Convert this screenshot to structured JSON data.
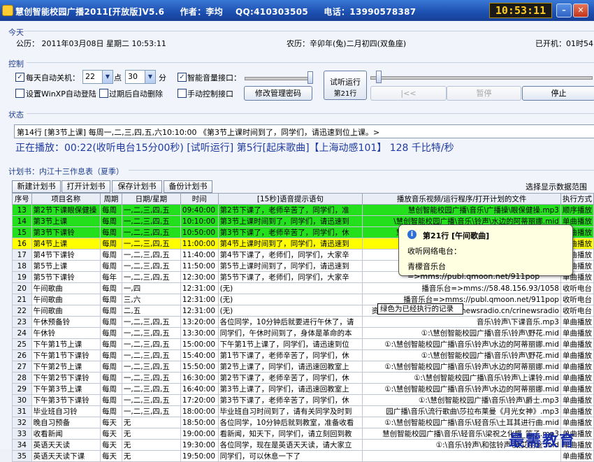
{
  "app": {
    "title": "慧创智能校园广播2011[开放版]V5.6",
    "author": "作者：李均",
    "qq": "QQ:410303505",
    "phone": "电话：13990578387",
    "clock": "10:53:11"
  },
  "today": {
    "group_label": "今天",
    "gregorian": "公历：  2011年03月08日  星期二  10:53:11",
    "lunar": "农历：辛卯年(兔)二月初四(双鱼座)",
    "uptime": "已开机：01时54"
  },
  "control": {
    "group_label": "控制",
    "auto_shutdown_label": "每天自动关机：",
    "hour_value": "22",
    "hour_unit": "点",
    "minute_value": "30",
    "minute_unit": "分",
    "smart_volume_label": "智能音量接口：",
    "setup_winxp_label": "设置WinXP自动登陆",
    "expired_delete_label": "过期后自动删除",
    "manual_control_label": "手动控制接口",
    "change_password_button": "修改管理密码",
    "trial_run_button_line1": "试听运行",
    "trial_run_button_line2": "第21行",
    "first_button": "|<<",
    "pause_button": "暂停",
    "stop_button": "停止"
  },
  "status": {
    "group_label": "状态",
    "line": "第14行  [第3节上课]  每周一,二,三,四,五,六10:10:00  《第3节上课时间到了，同学们，请迅速到位上课。>",
    "playing": "正在播放：00:22(收听电台15分00秒) [试听运行] 第5行[起床歌曲]【上海动感101】 128 千比特/秒"
  },
  "plan": {
    "header": "计划书：内江十三作息表（夏季）",
    "new_button": "新建计划书",
    "open_button": "打开计划书",
    "save_button": "保存计划书",
    "backup_button": "备份计划书",
    "range_label": "选择显示数据范围"
  },
  "table": {
    "columns": [
      "序号",
      "项目名称",
      "周期",
      "日期/星期",
      "时间",
      "[15秒]语音提示语句",
      "播放音乐视频/运行程序/打开计划的文件",
      "执行方式"
    ],
    "rows": [
      {
        "n": "13",
        "name": "第2节下课眼保健操",
        "period": "每周",
        "days": "一,二,三,四,五",
        "time": "09:40:00",
        "voice": "第2节下课了，老师辛苦了，同学们，准",
        "file": "慧创智能校园广播\\音乐\\广播操\\眼保健操.mp3",
        "mode": "顺序播放",
        "hl": "green"
      },
      {
        "n": "14",
        "name": "第3节上课",
        "period": "每周",
        "days": "一,二,三,四,五",
        "time": "10:10:00",
        "voice": "第3节上课时间到了，同学们，请迅速到",
        "file": "\\慧创智能校园广播\\音乐\\铃声\\水边的阿蒂丽娜.mid",
        "mode": "单曲播放",
        "hl": "green"
      },
      {
        "n": "15",
        "name": "第3节下课铃",
        "period": "每周",
        "days": "一,二,三,四,五",
        "time": "10:50:00",
        "voice": "第3节下课了，老师辛苦了，同学们，休",
        "file": "慧创智能校园广播\\音乐\\铃声\\水边的阿蒂丽娜.mid",
        "mode": "单曲播放",
        "hl": "green"
      },
      {
        "n": "16",
        "name": "第4节上课",
        "period": "每周",
        "days": "一,二,三,四,五",
        "time": "11:00:00",
        "voice": "第4节上课时间到了，同学们，请迅速到",
        "file": "\\慧创智能校园广播",
        "mode": "单曲播放",
        "hl": "yellow"
      },
      {
        "n": "17",
        "name": "第4节下课铃",
        "period": "每周",
        "days": "一,二,三,四,五",
        "time": "11:40:00",
        "voice": "第4节下课了，老师们，同学们，大家辛",
        "file": "",
        "mode": "单曲播放",
        "hl": ""
      },
      {
        "n": "18",
        "name": "第5节上课",
        "period": "每周",
        "days": "一,二,三,四,五",
        "time": "11:50:00",
        "voice": "第5节上课时间到了，同学们，请迅速到",
        "file": "",
        "mode": "单曲播放",
        "hl": ""
      },
      {
        "n": "19",
        "name": "第5节下课铃",
        "period": "每年",
        "days": "一,二,三,四,五",
        "time": "12:30:00",
        "voice": "第5节下课了，老师们，同学们，大家辛",
        "file": "",
        "mode": "单曲播放",
        "hl": ""
      },
      {
        "n": "20",
        "name": "午间歌曲",
        "period": "每周",
        "days": "一,四",
        "time": "12:31:00",
        "voice": "(无)",
        "file": "播音乐台=>mms://58.48.156.93/1058",
        "mode": "收听电台",
        "hl": ""
      },
      {
        "n": "21",
        "name": "午间歌曲",
        "period": "每周",
        "days": "三,六",
        "time": "12:31:00",
        "voice": "(无)",
        "file": "播音乐台=>mms://publ.qmoon.net/911pop",
        "mode": "收听电台",
        "hl": ""
      },
      {
        "n": "22",
        "name": "午间歌曲",
        "period": "每周",
        "days": "二,五",
        "time": "12:31:00",
        "voice": "(无)",
        "file": "资讯)=>mms://media.crinewsradio.cn/crinewsradio",
        "mode": "收听电台",
        "hl": ""
      },
      {
        "n": "23",
        "name": "午休预备铃",
        "period": "每周",
        "days": "一,二,三,四,五",
        "time": "13:20:00",
        "voice": "各位同学，10分钟后就要进行午休了，请",
        "file": "音乐\\铃声\\下课音乐.mp3",
        "mode": "单曲播放",
        "hl": ""
      },
      {
        "n": "24",
        "name": "午休铃",
        "period": "每周",
        "days": "一,二,三,四,五",
        "time": "13:30:00",
        "voice": "同学们，午休时间到了，身体是革命的本",
        "file": "①:\\慧创智能校园广播\\音乐\\铃声\\野花.mid",
        "mode": "单曲播放",
        "hl": ""
      },
      {
        "n": "25",
        "name": "下午第1节上课",
        "period": "每周",
        "days": "一,二,三,四,五",
        "time": "15:00:00",
        "voice": "下午第1节上课了，同学们，请迅速到位",
        "file": "①:\\慧创智能校园广播\\音乐\\铃声\\水边的阿蒂丽娜.mid",
        "mode": "单曲播放",
        "hl": ""
      },
      {
        "n": "26",
        "name": "下午第1节下课铃",
        "period": "每周",
        "days": "一,二,三,四,五",
        "time": "15:40:00",
        "voice": "第1节下课了，老师辛苦了，同学们，休",
        "file": "①:\\慧创智能校园广播\\音乐\\铃声\\野花.mid",
        "mode": "单曲播放",
        "hl": ""
      },
      {
        "n": "27",
        "name": "下午第2节上课",
        "period": "每周",
        "days": "一,二,三,四,五",
        "time": "15:50:00",
        "voice": "第2节上课了，同学们，请迅速回教室上",
        "file": "①:\\慧创智能校园广播\\音乐\\铃声\\水边的阿蒂丽娜.mid",
        "mode": "单曲播放",
        "hl": ""
      },
      {
        "n": "28",
        "name": "下午第2节下课铃",
        "period": "每周",
        "days": "一,二,三,四,五",
        "time": "16:30:00",
        "voice": "第2节下课了，老师辛苦了，同学们，休",
        "file": "①:\\慧创智能校园广播\\音乐\\铃声\\上课铃.mid",
        "mode": "单曲播放",
        "hl": ""
      },
      {
        "n": "29",
        "name": "下午第3节上课",
        "period": "每周",
        "days": "一,二,三,四,五",
        "time": "16:40:00",
        "voice": "第3节上课了，同学们，请迅速回教室上",
        "file": "①:\\慧创智能校园广播\\音乐\\铃声\\水边的阿蒂丽娜.mid",
        "mode": "单曲播放",
        "hl": ""
      },
      {
        "n": "30",
        "name": "下午第3节下课铃",
        "period": "每周",
        "days": "一,二,三,四,五",
        "time": "17:20:00",
        "voice": "第3节下课了，老师辛苦了，同学们，休",
        "file": "①:\\慧创智能校园广播\\音乐\\铃声\\爵士.mp3",
        "mode": "单曲播放",
        "hl": ""
      },
      {
        "n": "31",
        "name": "毕业班自习铃",
        "period": "每周",
        "days": "一,二,三,四,五",
        "time": "18:00:00",
        "voice": "毕业班自习时间到了，请有关同学及时到",
        "file": "园广播\\音乐\\流行歌曲\\莎拉布莱曼《月光女神》.mp3",
        "mode": "单曲播放",
        "hl": ""
      },
      {
        "n": "32",
        "name": "晚自习预备",
        "period": "每天",
        "days": "无",
        "time": "18:50:00",
        "voice": "各位同学，10分钟后就到教室，准备收看",
        "file": "①:\\慧创智能校园广播\\音乐\\轻音乐\\土耳其进行曲.mid",
        "mode": "单曲播放",
        "hl": ""
      },
      {
        "n": "33",
        "name": "收看新闻",
        "period": "每天",
        "days": "无",
        "time": "19:00:00",
        "voice": "看新闻，知天下，同学们，请立刻回到教",
        "file": "慧创智能校园广播\\音乐\\轻音乐\\梁祝之化蝶_笛子.mp3",
        "mode": "单曲播放",
        "hl": ""
      },
      {
        "n": "34",
        "name": "英语天天读",
        "period": "每天",
        "days": "无",
        "time": "19:30:00",
        "voice": "各位同学，现在是英语天天读，请大家立",
        "file": "①:\\音乐\\铃声\\和弦铃声\\致艾丽丝.mid",
        "mode": "单曲播放",
        "hl": ""
      },
      {
        "n": "35",
        "name": "英语天天读下课",
        "period": "每天",
        "days": "无",
        "time": "19:50:00",
        "voice": "同学们，可以休息一下了",
        "file": "",
        "mode": "单曲播放",
        "hl": ""
      }
    ]
  },
  "tooltip": {
    "title": "第21行 [午间歌曲]",
    "line1": "收听网络电台：",
    "line2": "青檬音乐台=>mms://publ.qmoon.net/911pop"
  },
  "legend": "绿色为已经执行的记录",
  "watermark": "最需教育"
}
